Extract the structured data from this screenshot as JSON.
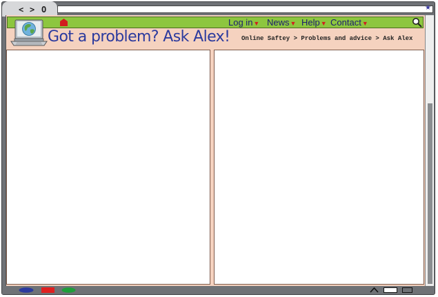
{
  "browser": {
    "nav": {
      "back": "<",
      "forward": ">",
      "reload": "O"
    },
    "address": {
      "value": ""
    },
    "bookmark_icon": "★"
  },
  "site": {
    "menu": [
      {
        "label": "Log in",
        "icon": "dropdown-arrow-icon"
      },
      {
        "label": "News",
        "icon": "dropdown-arrow-icon"
      },
      {
        "label": "Help",
        "icon": "dropdown-arrow-icon"
      },
      {
        "label": "Contact",
        "icon": "dropdown-arrow-icon"
      }
    ],
    "title": "Got a problem? Ask Alex!",
    "breadcrumb": "Online Saftey > Problems and advice > Ask Alex"
  },
  "colors": {
    "nav_green": "#8dc63f",
    "page_bg": "#f5d2bf",
    "title_blue": "#2b3a9e",
    "arrow_red": "#d11e1e",
    "taskbar_blue": "#2b3a9e",
    "taskbar_red": "#e02020",
    "taskbar_green": "#1f9e3a"
  },
  "icons": [
    "home-icon",
    "search-icon",
    "laptop-globe-icon",
    "caret-up-icon",
    "window-icon"
  ]
}
